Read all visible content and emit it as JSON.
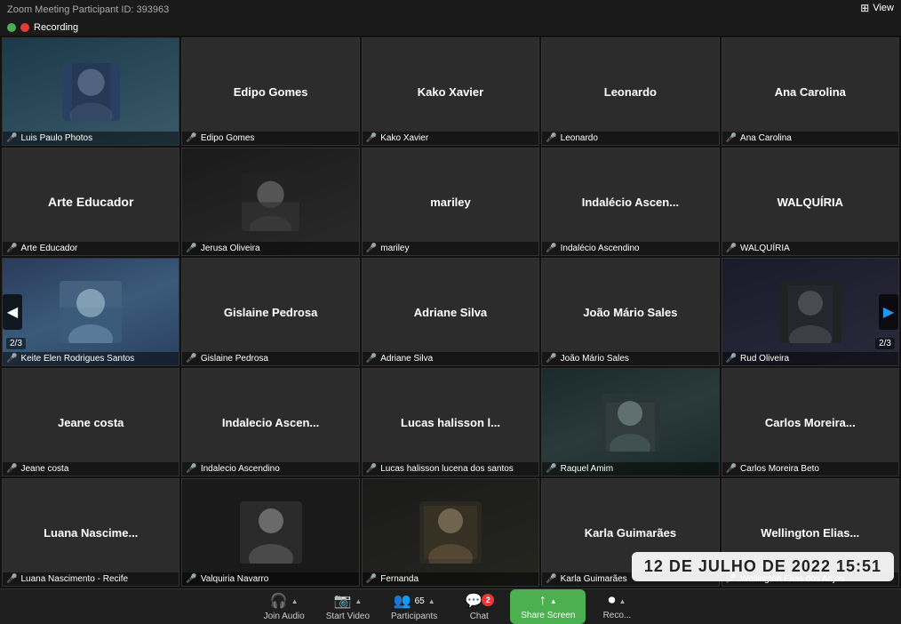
{
  "titleBar": {
    "title": "Zoom Meeting Participant ID: 393963",
    "recording": "Recording",
    "viewLabel": "View"
  },
  "grid": {
    "pages": "2/3",
    "participants": [
      {
        "id": 1,
        "name": "",
        "label": "Luis Paulo Photos",
        "hasPhoto": true,
        "photoType": "person1",
        "row": 1,
        "col": 1
      },
      {
        "id": 2,
        "name": "Edipo Gomes",
        "label": "Edipo Gomes",
        "hasPhoto": false,
        "row": 1,
        "col": 2
      },
      {
        "id": 3,
        "name": "Kako Xavier",
        "label": "Kako Xavier",
        "hasPhoto": false,
        "row": 1,
        "col": 3
      },
      {
        "id": 4,
        "name": "Leonardo",
        "label": "Leonardo",
        "hasPhoto": false,
        "row": 1,
        "col": 4
      },
      {
        "id": 5,
        "name": "Ana Carolina",
        "label": "Ana Carolina",
        "hasPhoto": false,
        "row": 1,
        "col": 5
      },
      {
        "id": 6,
        "name": "Arte Educador",
        "label": "Arte Educador",
        "hasPhoto": false,
        "row": 2,
        "col": 1
      },
      {
        "id": 7,
        "name": "",
        "label": "Jerusa Oliveira",
        "hasPhoto": true,
        "photoType": "person2",
        "row": 2,
        "col": 2
      },
      {
        "id": 8,
        "name": "mariley",
        "label": "mariley",
        "hasPhoto": false,
        "row": 2,
        "col": 3
      },
      {
        "id": 9,
        "name": "Indalécio  Ascen...",
        "label": "Indalécio Ascendino",
        "hasPhoto": false,
        "row": 2,
        "col": 4
      },
      {
        "id": 10,
        "name": "WALQUÍRIA",
        "label": "WALQUÍRIA",
        "hasPhoto": false,
        "row": 2,
        "col": 5
      },
      {
        "id": 11,
        "name": "",
        "label": "Keite Elen Rodrigues Santos",
        "hasPhoto": true,
        "photoType": "person3",
        "row": 3,
        "col": 1
      },
      {
        "id": 12,
        "name": "Gislaine Pedrosa",
        "label": "Gislaine Pedrosa",
        "hasPhoto": false,
        "row": 3,
        "col": 2
      },
      {
        "id": 13,
        "name": "Adriane Silva",
        "label": "Adriane Silva",
        "hasPhoto": false,
        "row": 3,
        "col": 3
      },
      {
        "id": 14,
        "name": "João Mário Sales",
        "label": "João Mário Sales",
        "hasPhoto": false,
        "row": 3,
        "col": 4
      },
      {
        "id": 15,
        "name": "",
        "label": "Rud Oliveira",
        "hasPhoto": true,
        "photoType": "person4",
        "row": 3,
        "col": 5
      },
      {
        "id": 16,
        "name": "Jeane costa",
        "label": "Jeane costa",
        "hasPhoto": false,
        "row": 4,
        "col": 1
      },
      {
        "id": 17,
        "name": "Indalecio  Ascen...",
        "label": "Indalecio Ascendino",
        "hasPhoto": false,
        "row": 4,
        "col": 2
      },
      {
        "id": 18,
        "name": "Lucas halisson l...",
        "label": "Lucas halisson lucena dos santos",
        "hasPhoto": false,
        "row": 4,
        "col": 3
      },
      {
        "id": 19,
        "name": "",
        "label": "Raquel Amim",
        "hasPhoto": true,
        "photoType": "person5",
        "row": 4,
        "col": 4
      },
      {
        "id": 20,
        "name": "Carlos  Moreira...",
        "label": "Carlos Moreira Beto",
        "hasPhoto": false,
        "row": 4,
        "col": 5
      },
      {
        "id": 21,
        "name": "Luana  Nascime...",
        "label": "Luana Nascimento - Recife",
        "hasPhoto": false,
        "row": 5,
        "col": 1
      },
      {
        "id": 22,
        "name": "",
        "label": "Valquiria Navarro",
        "hasPhoto": true,
        "photoType": "person6",
        "row": 5,
        "col": 2
      },
      {
        "id": 23,
        "name": "",
        "label": "Fernanda",
        "hasPhoto": true,
        "photoType": "person7",
        "row": 5,
        "col": 3
      },
      {
        "id": 24,
        "name": "Karla Guimarães",
        "label": "Karla Guimarães",
        "hasPhoto": false,
        "row": 5,
        "col": 4
      },
      {
        "id": 25,
        "name": "Wellington  Elias...",
        "label": "Wellington Elias dos Anjos",
        "hasPhoto": false,
        "row": 5,
        "col": 5
      }
    ]
  },
  "datetime": "12 DE JULHO DE 2022 15:51",
  "toolbar": {
    "joinAudio": "Join Audio",
    "startVideo": "Start Video",
    "participants": "Participants",
    "participantCount": "65",
    "chat": "Chat",
    "chatBadge": "2",
    "shareScreen": "Share Screen",
    "record": "Reco..."
  },
  "navigation": {
    "leftArrow": "◀",
    "rightArrow": "▶",
    "pageLeft": "2/3",
    "pageRight": "2/3"
  }
}
